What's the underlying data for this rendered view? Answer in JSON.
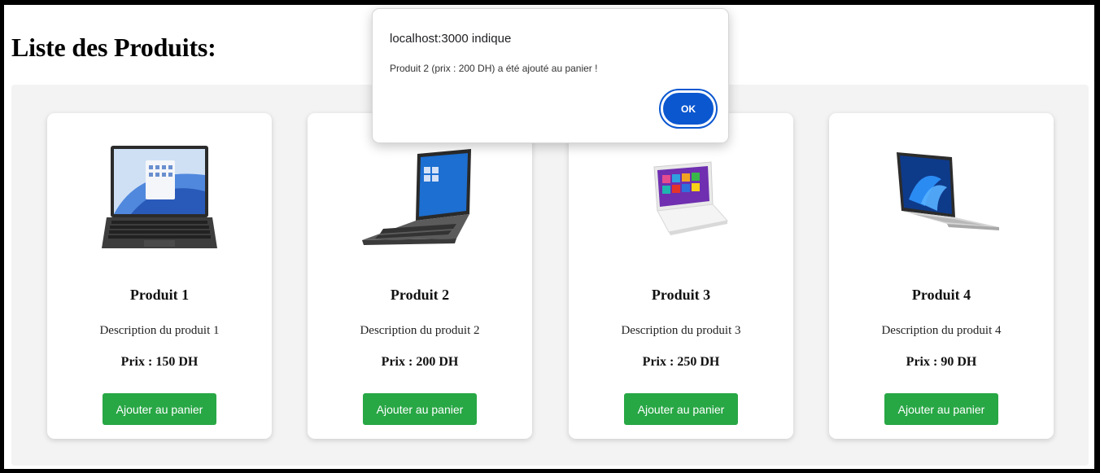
{
  "page": {
    "title": "Liste des Produits:"
  },
  "products": [
    {
      "name": "Produit 1",
      "description": "Description du produit 1",
      "price": "Prix : 150 DH",
      "button_label": "Ajouter au panier",
      "image": "laptop-front-view-icon"
    },
    {
      "name": "Produit 2",
      "description": "Description du produit 2",
      "price": "Prix : 200 DH",
      "button_label": "Ajouter au panier",
      "image": "laptop-angled-dark-icon"
    },
    {
      "name": "Produit 3",
      "description": "Description du produit 3",
      "price": "Prix : 250 DH",
      "button_label": "Ajouter au panier",
      "image": "laptop-white-icon"
    },
    {
      "name": "Produit 4",
      "description": "Description du produit 4",
      "price": "Prix : 90 DH",
      "button_label": "Ajouter au panier",
      "image": "laptop-silver-icon"
    }
  ],
  "dialog": {
    "title": "localhost:3000 indique",
    "message": "Produit 2 (prix : 200 DH) a été ajouté au panier !",
    "ok_label": "OK"
  },
  "colors": {
    "button_green": "#28a745",
    "dialog_blue": "#0b57d0",
    "panel_gray": "#f3f3f3"
  }
}
